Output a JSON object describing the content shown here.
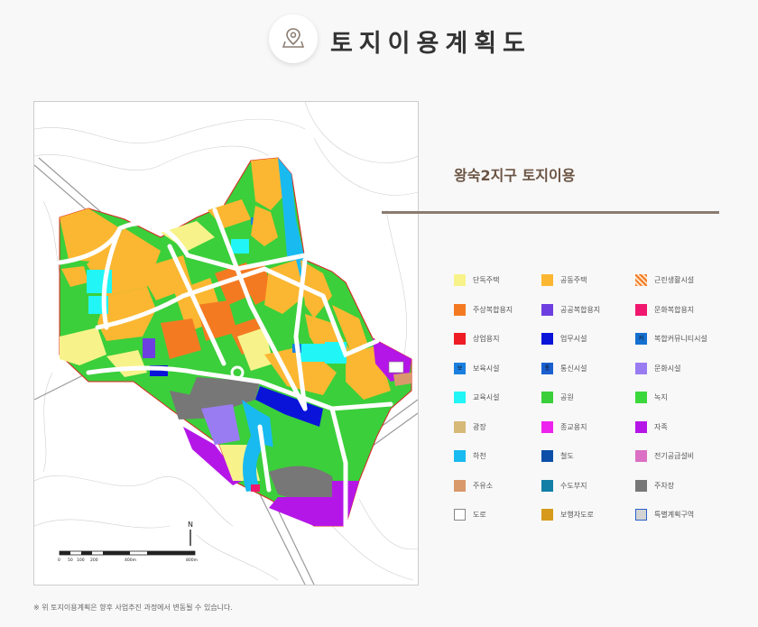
{
  "header": {
    "title": "토지이용계획도",
    "icon": "map-pin-icon"
  },
  "zone_title": "왕숙2지구 토지이용",
  "legend": [
    {
      "label": "단독주택",
      "color": "#f7f38a",
      "key": "detached-housing"
    },
    {
      "label": "공동주택",
      "color": "#fbb731",
      "key": "apartment-housing"
    },
    {
      "label": "근린생활시설",
      "color": "#f5a25a",
      "pattern": "check",
      "key": "neighborhood-facility"
    },
    {
      "label": "주상복합용지",
      "color": "#f47a22",
      "key": "mixed-residential-commercial"
    },
    {
      "label": "공공복합용지",
      "color": "#6d3fe0",
      "key": "public-complex"
    },
    {
      "label": "문화복합용지",
      "color": "#f0186e",
      "key": "culture-complex"
    },
    {
      "label": "상업용지",
      "color": "#ee1c25",
      "key": "commercial"
    },
    {
      "label": "업무시설",
      "color": "#0a14d8",
      "key": "business-facility"
    },
    {
      "label": "복합커뮤니티시설",
      "color": "#1570d0",
      "mark": "커",
      "key": "community-facility"
    },
    {
      "label": "보육시설",
      "color": "#1a80e0",
      "mark": "보",
      "key": "childcare"
    },
    {
      "label": "통신시설",
      "color": "#1a5fd0",
      "mark": "통",
      "key": "telecom"
    },
    {
      "label": "문화시설",
      "color": "#9a7cf2",
      "key": "culture-facility"
    },
    {
      "label": "교육시설",
      "color": "#22f5f5",
      "key": "education"
    },
    {
      "label": "공원",
      "color": "#3bcf3b",
      "key": "park"
    },
    {
      "label": "녹지",
      "color": "#3bd83b",
      "key": "green-area"
    },
    {
      "label": "광장",
      "color": "#d6b877",
      "key": "plaza"
    },
    {
      "label": "종교용지",
      "color": "#ee22ee",
      "key": "religious"
    },
    {
      "label": "자족",
      "color": "#b516e8",
      "key": "self-sufficient"
    },
    {
      "label": "하천",
      "color": "#19baf0",
      "key": "river"
    },
    {
      "label": "철도",
      "color": "#0c4fa8",
      "key": "railway"
    },
    {
      "label": "전기공급설비",
      "color": "#db6fc4",
      "key": "power-supply"
    },
    {
      "label": "주유소",
      "color": "#d9996a",
      "key": "gas-station"
    },
    {
      "label": "수도부지",
      "color": "#127fa6",
      "key": "water-supply"
    },
    {
      "label": "주차장",
      "color": "#777777",
      "key": "parking"
    },
    {
      "label": "도로",
      "color": "#ffffff",
      "border": "#888888",
      "key": "road"
    },
    {
      "label": "보행자도로",
      "color": "#d69a1c",
      "key": "pedestrian-road"
    },
    {
      "label": "특별계획구역",
      "color": "#d3d3d3",
      "border": "#2a60c8",
      "key": "special-planning-zone"
    }
  ],
  "map": {
    "north_label": "N",
    "scale_labels": [
      "0",
      "50",
      "100",
      "200",
      "400m",
      "800m"
    ]
  },
  "footnote": "※ 위 토지이용계획은 향후 사업추진 과정에서 변동될 수 있습니다."
}
